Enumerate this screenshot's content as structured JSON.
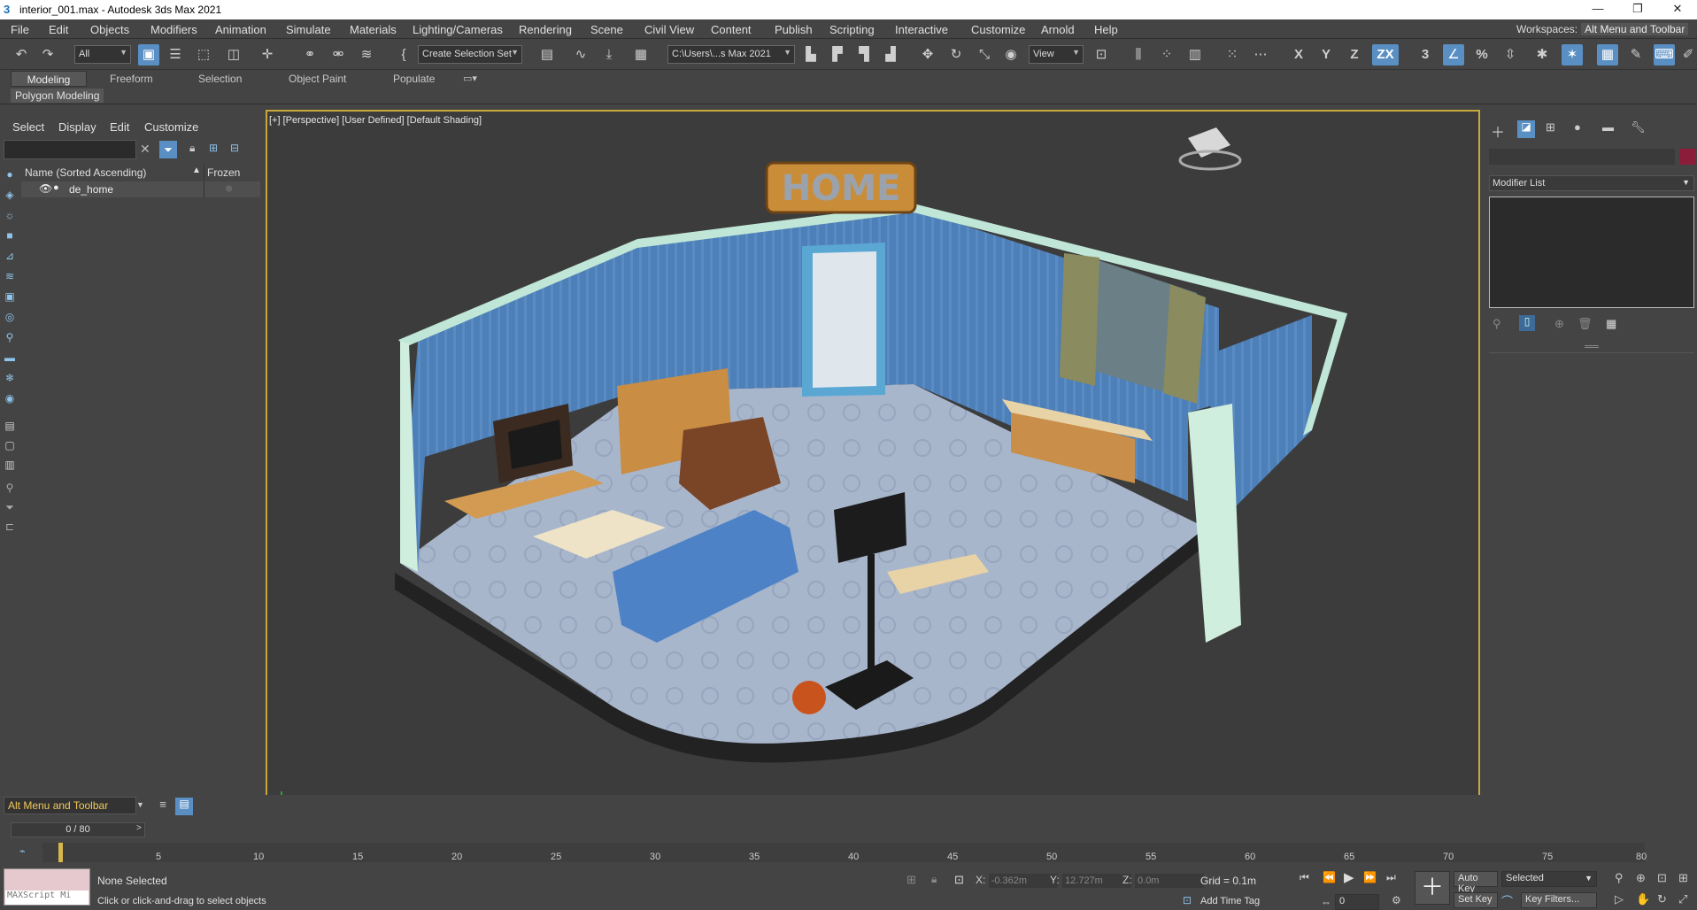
{
  "window": {
    "title": "interior_001.max - Autodesk 3ds Max 2021"
  },
  "menubar": {
    "items": [
      "File",
      "Edit",
      "Objects",
      "Modifiers",
      "Animation",
      "Simulate",
      "Materials",
      "Lighting/Cameras",
      "Rendering",
      "Scene",
      "Civil View",
      "Content",
      "Publish",
      "Scripting",
      "Interactive",
      "Customize",
      "Arnold",
      "Help"
    ],
    "workspaces_label": "Workspaces:",
    "workspaces_value": "Alt Menu and Toolbar"
  },
  "toolbar": {
    "filter_value": "All",
    "selection_set_value": "Create Selection Set",
    "path_value": "C:\\Users\\...s Max 2021",
    "view_value": "View",
    "axis_x": "X",
    "axis_y": "Y",
    "axis_z": "Z",
    "axis_zx": "ZX",
    "snap_3": "3",
    "snap_percent": "%"
  },
  "ribbon": {
    "tabs": [
      "Modeling",
      "Freeform",
      "Selection",
      "Object Paint",
      "Populate"
    ],
    "sub_label": "Polygon Modeling"
  },
  "explorer": {
    "tabs": [
      "Select",
      "Display",
      "Edit",
      "Customize"
    ],
    "col_name": "Name (Sorted Ascending)",
    "col_frozen": "Frozen",
    "rows": [
      {
        "name": "de_home"
      }
    ]
  },
  "viewport": {
    "label_plus": "[+]",
    "label_view": "[Perspective]",
    "label_user": "[User Defined]",
    "label_shading": "[Default Shading]",
    "sign_text": "HOME"
  },
  "command_panel": {
    "modifier_list": "Modifier List"
  },
  "bottom": {
    "script_combo": "Alt Menu and Toolbar",
    "frame_counter": "0 / 80",
    "timeline_labels": [
      "5",
      "10",
      "15",
      "20",
      "25",
      "30",
      "35",
      "40",
      "45",
      "50",
      "55",
      "60",
      "65",
      "70",
      "75",
      "80"
    ],
    "maxscript_placeholder": "MAXScript Mi",
    "status": "None Selected",
    "prompt": "Click or click-and-drag to select objects",
    "coord_x_label": "X:",
    "coord_x": "-0.362m",
    "coord_y_label": "Y:",
    "coord_y": "12.727m",
    "coord_z_label": "Z:",
    "coord_z": "0.0m",
    "grid": "Grid = 0.1m",
    "add_time_tag": "Add Time Tag",
    "auto_key": "Auto Key",
    "selected_value": "Selected",
    "set_key": "Set Key",
    "key_filters": "Key Filters...",
    "frame_value": "0"
  }
}
